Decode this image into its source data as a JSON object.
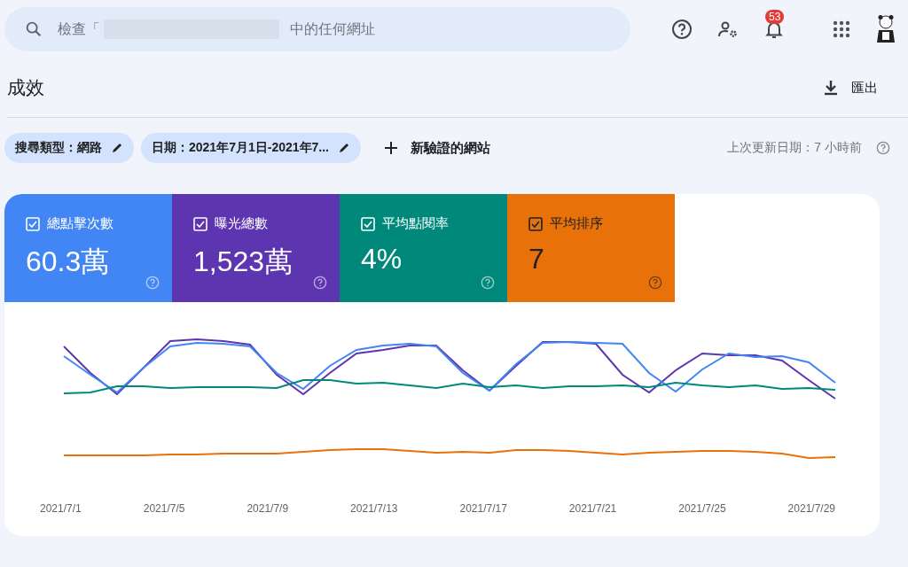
{
  "search": {
    "placeholder_start": "檢查「",
    "placeholder_end": "中的任何網址"
  },
  "notifications": {
    "count": "53"
  },
  "page": {
    "title": "成效",
    "export_label": "匯出"
  },
  "filters": [
    {
      "label": "搜尋類型：網路"
    },
    {
      "label": "日期：2021年7月1日-2021年7..."
    }
  ],
  "add_filter": "新驗證的網站",
  "last_updated": "上次更新日期：7 小時前",
  "metrics": [
    {
      "label": "總點擊次數",
      "value": "60.3萬",
      "checked": true,
      "color": "#4285f4"
    },
    {
      "label": "曝光總數",
      "value": "1,523萬",
      "checked": true,
      "color": "#5e35b1"
    },
    {
      "label": "平均點閱率",
      "value": "4%",
      "checked": true,
      "color": "#00897b"
    },
    {
      "label": "平均排序",
      "value": "7",
      "checked": true,
      "color": "#e8710a"
    }
  ],
  "x_labels": [
    "2021/7/1",
    "2021/7/5",
    "2021/7/9",
    "2021/7/13",
    "2021/7/17",
    "2021/7/21",
    "2021/7/25",
    "2021/7/29"
  ]
}
